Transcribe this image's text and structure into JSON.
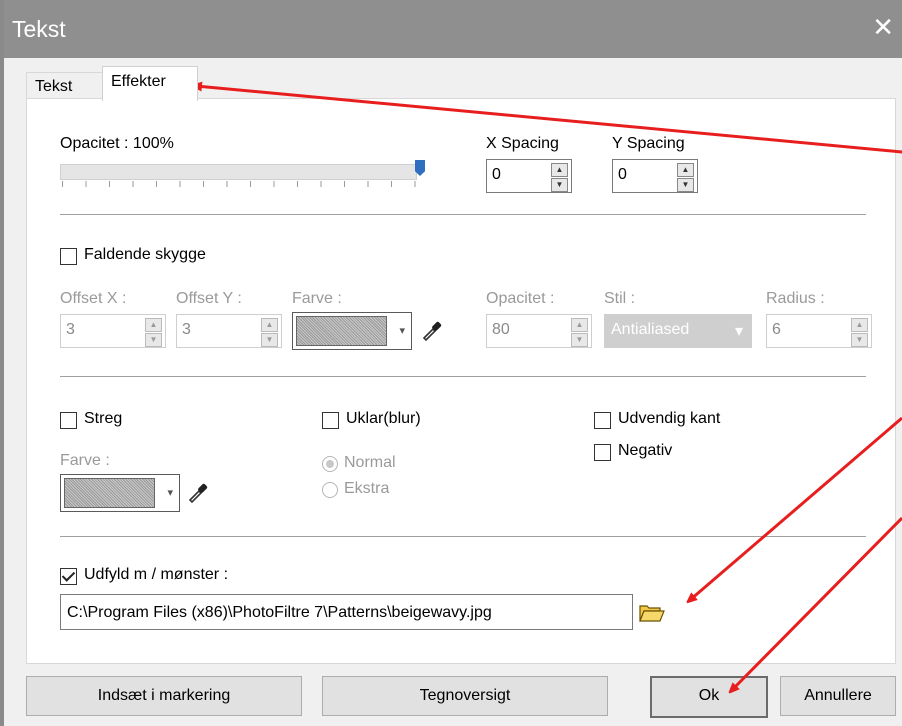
{
  "window": {
    "title": "Tekst",
    "close_glyph": "✕"
  },
  "tabs": [
    {
      "label": "Tekst",
      "active": false
    },
    {
      "label": "Effekter",
      "active": true
    }
  ],
  "opacity": {
    "label": "Opacitet : 100%",
    "value_percent": 100
  },
  "spacing": {
    "x_label": "X Spacing",
    "x_value": "0",
    "y_label": "Y Spacing",
    "y_value": "0"
  },
  "shadow": {
    "checkbox_label": "Faldende skygge",
    "checked": false,
    "offset_x_label": "Offset X :",
    "offset_x_value": "3",
    "offset_y_label": "Offset Y :",
    "offset_y_value": "3",
    "color_label": "Farve :",
    "opacity_label": "Opacitet :",
    "opacity_value": "80",
    "style_label": "Stil :",
    "style_value": "Antialiased",
    "radius_label": "Radius :",
    "radius_value": "6"
  },
  "stroke": {
    "checkbox_label": "Streg",
    "checked": false,
    "color_label": "Farve :"
  },
  "blur": {
    "checkbox_label": "Uklar(blur)",
    "checked": false,
    "options": [
      "Normal",
      "Ekstra"
    ],
    "selected": "Normal"
  },
  "outer_edge": {
    "checkbox_label": "Udvendig kant",
    "checked": false
  },
  "negative": {
    "checkbox_label": "Negativ",
    "checked": false
  },
  "fill_pattern": {
    "checkbox_label": "Udfyld m / mønster :",
    "checked": true,
    "path": "C:\\Program Files (x86)\\PhotoFiltre 7\\Patterns\\beigewavy.jpg"
  },
  "buttons": {
    "insert": "Indsæt i markering",
    "charmap": "Tegnoversigt",
    "ok": "Ok",
    "cancel": "Annullere"
  },
  "icons": {
    "dropper": "eyedropper-icon",
    "folder": "open-folder-icon",
    "spin_up": "▲",
    "spin_down": "▼",
    "dropdown": "▾"
  },
  "colors": {
    "annotation_arrow": "#e81e1e",
    "titlebar": "#8f8f8f",
    "slider_thumb": "#2f6fbf"
  }
}
